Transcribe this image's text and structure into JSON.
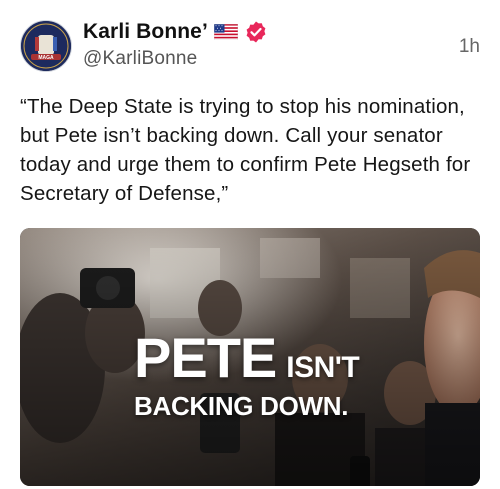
{
  "post": {
    "author": {
      "display_name": "Karli Bonne’",
      "handle": "@KarliBonne",
      "avatar_icon": "avatar-image",
      "flag_icon": "us-flag-icon",
      "verified_icon": "verified-badge-icon",
      "verified_color": "#e8275a"
    },
    "timestamp": "1h",
    "text": "“The Deep State is trying to stop his nomination, but Pete isn’t backing down. Call your senator today and urge them to confirm Pete Hegseth for Secretary of Defense,”",
    "media": {
      "overlay_word_big": "PETE",
      "overlay_word_small": "ISN'T",
      "overlay_line2": "BACKING DOWN."
    }
  }
}
